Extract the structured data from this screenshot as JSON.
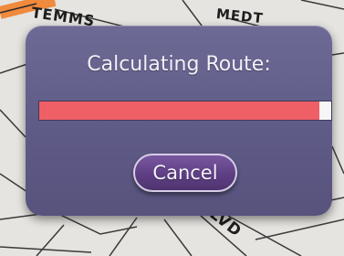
{
  "map": {
    "street_labels": [
      "TEMMS",
      "MEDT",
      "LVD"
    ]
  },
  "dialog": {
    "title": "Calculating Route:",
    "progress_fraction": 0.96,
    "cancel_label": "Cancel"
  },
  "colors": {
    "dialog_background": "#645f8c",
    "progress_fill": "#ef5f66",
    "progress_track": "#f6f6f6",
    "button_background": "#6a4b92",
    "road_highlight": "#f08a3c"
  }
}
